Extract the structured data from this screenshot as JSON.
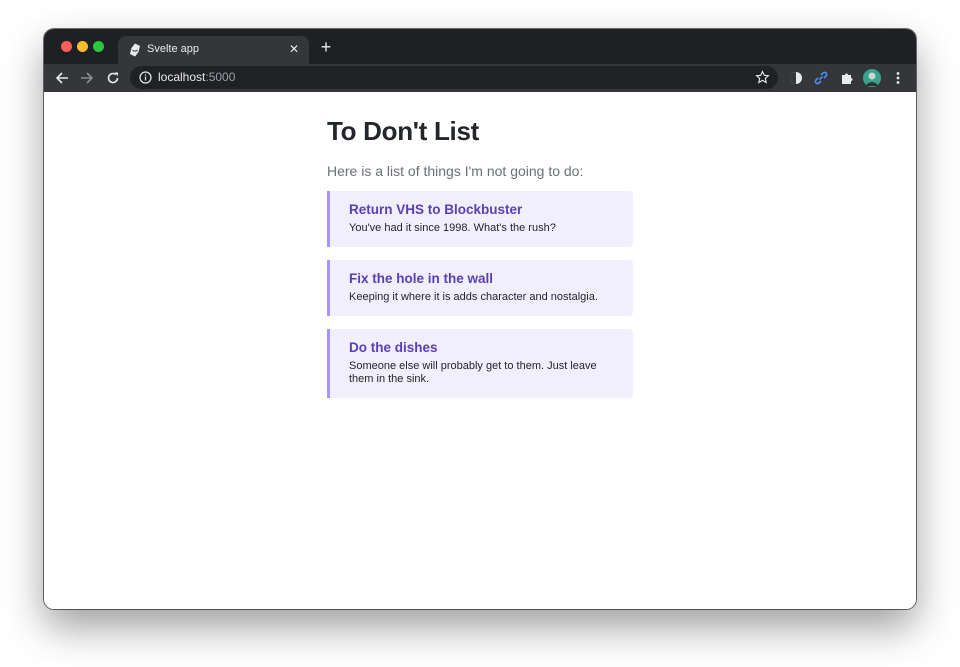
{
  "browser": {
    "tab_title": "Svelte app",
    "tab_close": "✕",
    "new_tab": "+",
    "url_host": "localhost",
    "url_port": ":5000"
  },
  "page": {
    "title": "To Don't List",
    "intro": "Here is a list of things I'm not going to do:"
  },
  "items": [
    {
      "title": "Return VHS to Blockbuster",
      "description": "You've had it since 1998. What's the rush?"
    },
    {
      "title": "Fix the hole in the wall",
      "description": "Keeping it where it is adds character and nostalgia."
    },
    {
      "title": "Do the dishes",
      "description": "Someone else will probably get to them. Just leave them in the sink."
    }
  ],
  "colors": {
    "accent": "#5a3fb2",
    "card_background": "#f1eefe",
    "card_border": "#a994f0"
  }
}
